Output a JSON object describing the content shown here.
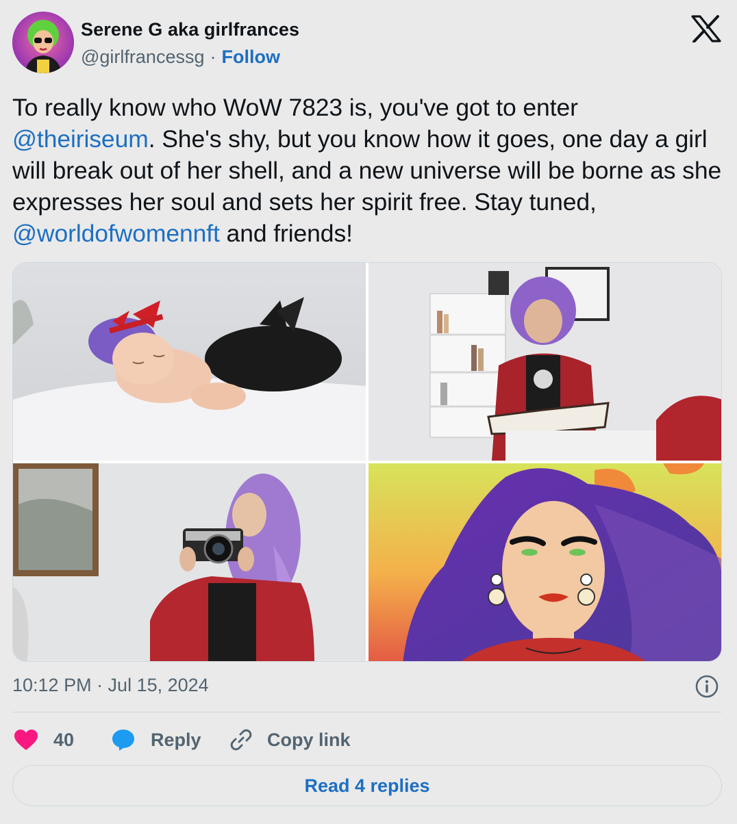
{
  "author": {
    "display_name": "Serene G aka girlfrances",
    "handle": "@girlfrancessg",
    "separator": "·",
    "follow_label": "Follow"
  },
  "tweet": {
    "text_1": "To really know who WoW 7823 is, you've got to enter ",
    "mention_1": "@theiriseum",
    "text_2": ". She's shy, but you know how it goes, one day a girl will break out of her shell, and a new universe will be borne as she expresses her soul and sets her spirit free. Stay tuned, ",
    "mention_2": "@worldofwomennft",
    "text_3": " and friends!"
  },
  "media": [
    {
      "icon": "photo-sleeping-baby"
    },
    {
      "icon": "photo-girl-reading-book"
    },
    {
      "icon": "photo-girl-with-camera"
    },
    {
      "icon": "illustration-woman-purple-hair"
    }
  ],
  "meta": {
    "timestamp": "10:12 PM · Jul 15, 2024"
  },
  "actions": {
    "like_count": "40",
    "reply_label": "Reply",
    "copy_label": "Copy link"
  },
  "read_replies_label": "Read 4 replies",
  "colors": {
    "link": "#1d6fc2",
    "like": "#f91880",
    "reply_icon": "#1d9bf0",
    "muted": "#536471"
  }
}
